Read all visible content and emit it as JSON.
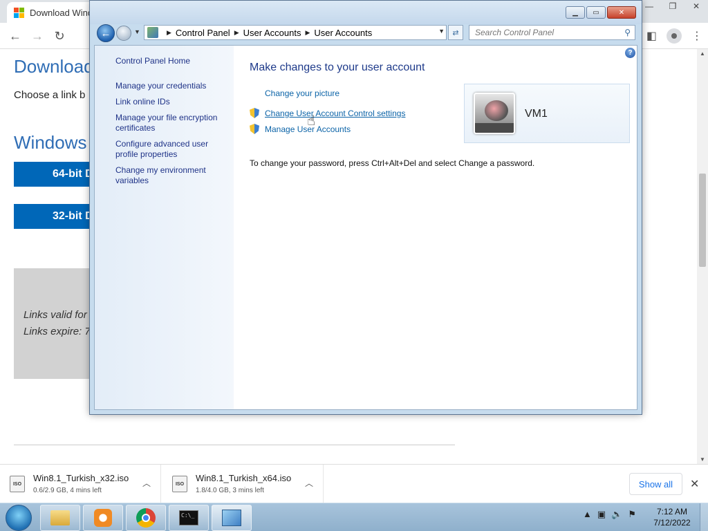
{
  "browser": {
    "tab_title": "Download Wind",
    "page_heading": "Download",
    "page_subtext": "Choose a link b",
    "windows_heading": "Windows",
    "btn_64": "64-bit D",
    "btn_32": "32-bit D",
    "links_valid": "Links valid for",
    "links_expire": "Links expire: 7",
    "ms_colors": [
      "#f25022",
      "#7fba00",
      "#00a4ef",
      "#ffb900"
    ]
  },
  "cp": {
    "breadcrumb": [
      "Control Panel",
      "User Accounts",
      "User Accounts"
    ],
    "search_placeholder": "Search Control Panel",
    "side_links": [
      "Control Panel Home",
      "Manage your credentials",
      "Link online IDs",
      "Manage your file encryption certificates",
      "Configure advanced user profile properties",
      "Change my environment variables"
    ],
    "heading": "Make changes to your user account",
    "tasks": [
      "Change your picture",
      "Change User Account Control settings",
      "Manage User Accounts"
    ],
    "note": "To change your password, press Ctrl+Alt+Del and select Change a password.",
    "user_name": "VM1",
    "help_label": "?"
  },
  "downloads": [
    {
      "name": "Win8.1_Turkish_x32.iso",
      "status": "0.6/2.9 GB, 4 mins left",
      "icon": "ISO"
    },
    {
      "name": "Win8.1_Turkish_x64.iso",
      "status": "1.8/4.0 GB, 3 mins left",
      "icon": "ISO"
    }
  ],
  "download_bar": {
    "show_all": "Show all"
  },
  "clock": {
    "time": "7:12 AM",
    "date": "7/12/2022"
  }
}
